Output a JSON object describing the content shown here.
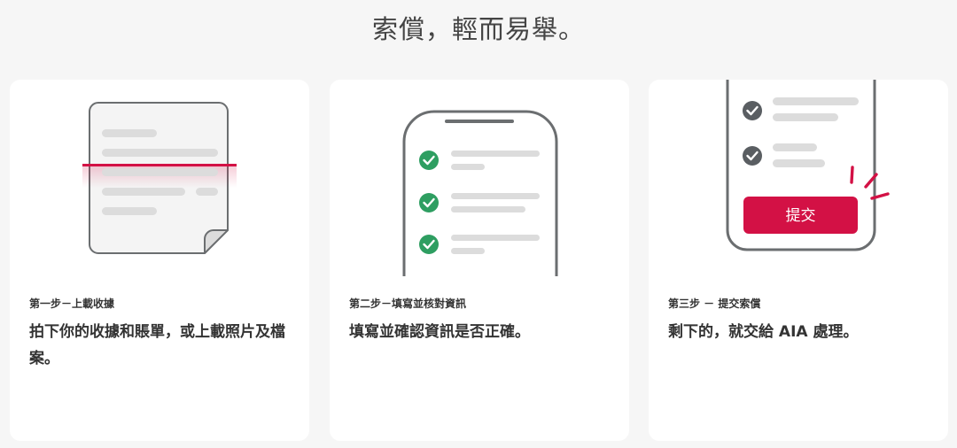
{
  "headline": "索償，輕而易舉。",
  "steps": [
    {
      "label": "第一步－上載收據",
      "description": "拍下你的收據和賬單，或上載照片及檔案。"
    },
    {
      "label": "第二步－填寫並核對資訊",
      "description": "填寫並確認資訊是否正確。"
    },
    {
      "label": "第三步 － 提交索償",
      "description": "剩下的，就交給 AIA 處理。"
    }
  ],
  "submit_button_label": "提交",
  "colors": {
    "accent_red": "#d31145",
    "check_green": "#2e9e61",
    "check_dark": "#5a5e62",
    "outline": "#6b6e70",
    "skeleton": "#dcdcdc",
    "card_bg": "#ffffff",
    "page_bg": "#f6f6f6"
  }
}
